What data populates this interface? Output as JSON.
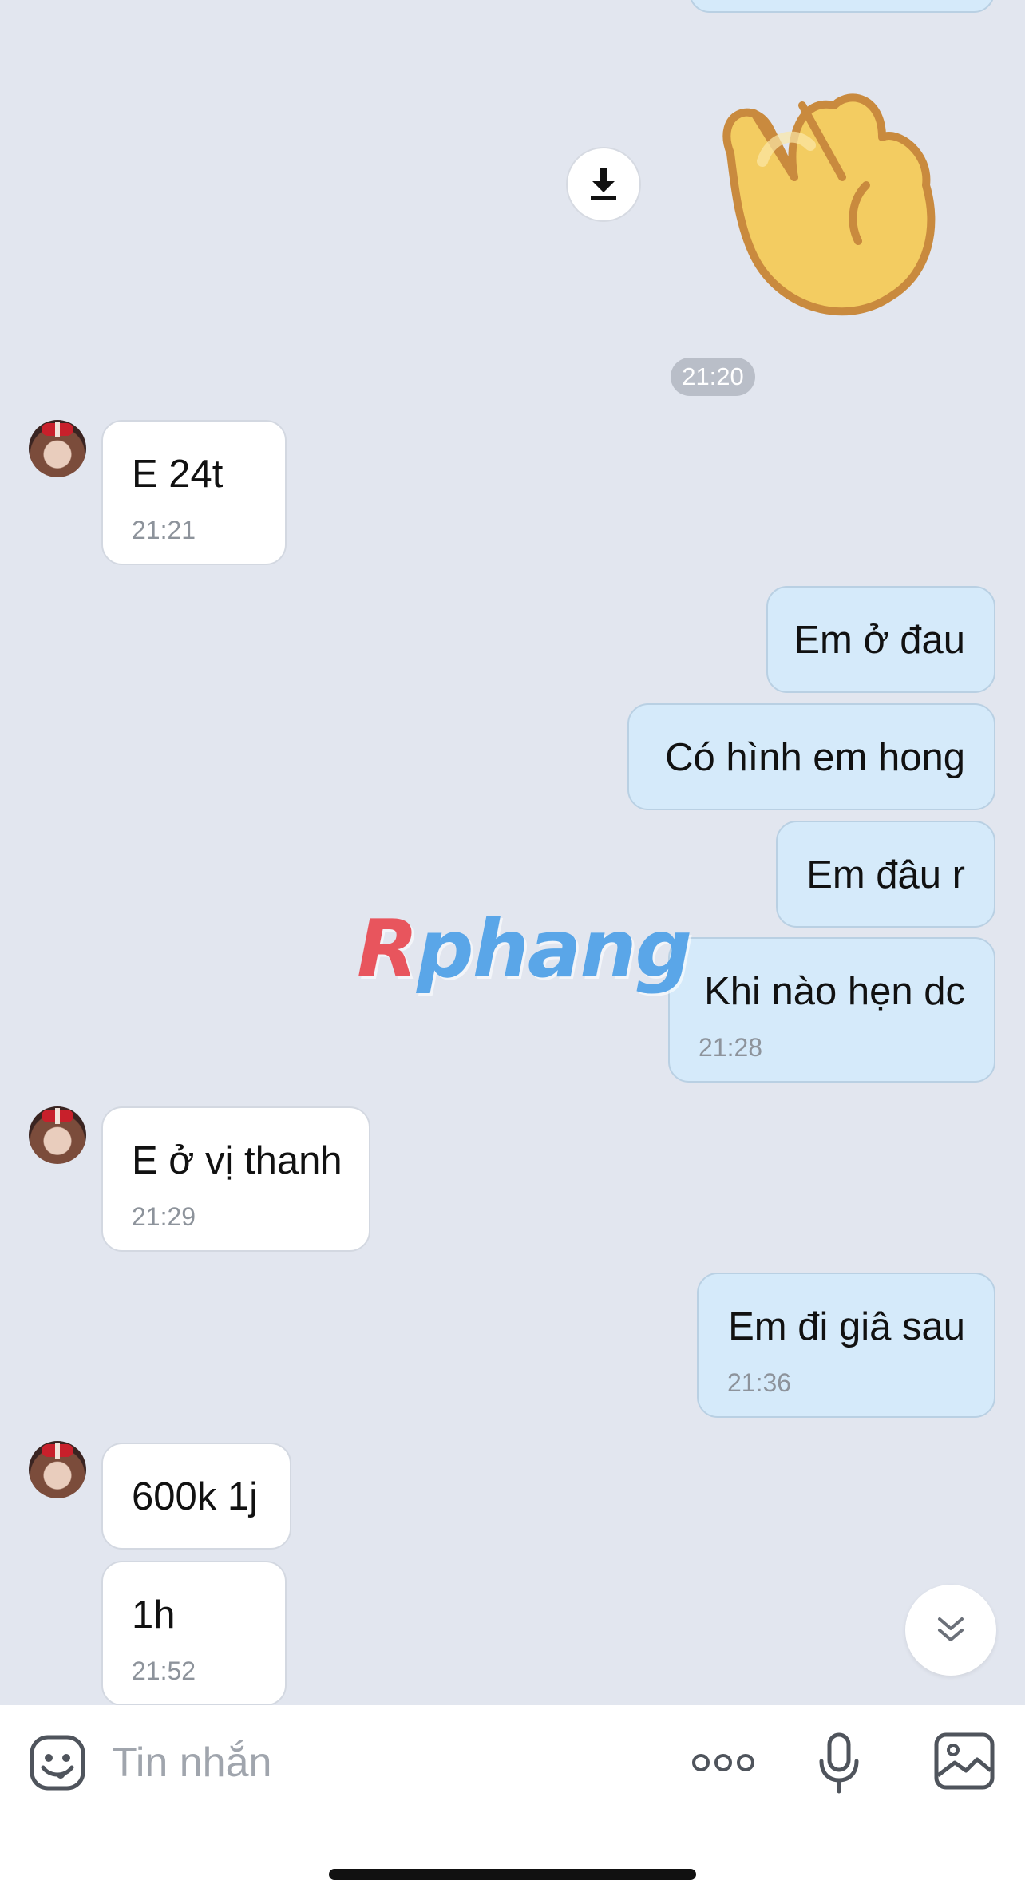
{
  "chat": {
    "time_separator": "21:20",
    "messages": [
      {
        "side": "in",
        "text": "E 24t",
        "time": "21:21"
      },
      {
        "side": "out",
        "text": "Em ở đau",
        "time": ""
      },
      {
        "side": "out",
        "text": "Có hình em hong",
        "time": ""
      },
      {
        "side": "out",
        "text": "Em đâu r",
        "time": ""
      },
      {
        "side": "out",
        "text": "Khi nào hẹn dc",
        "time": "21:28"
      },
      {
        "side": "in",
        "text": "E ở vị thanh",
        "time": "21:29"
      },
      {
        "side": "out",
        "text": "Em đi giâ sau",
        "time": "21:36"
      },
      {
        "side": "in",
        "text": "600k 1j",
        "time": ""
      },
      {
        "side": "in",
        "text": "1h",
        "time": "21:52"
      }
    ],
    "sticker": "waving-hand",
    "watermark": {
      "first": "R",
      "rest": "phang"
    }
  },
  "input": {
    "placeholder": "Tin nhắn",
    "value": ""
  },
  "colors": {
    "background": "#e2e6ef",
    "incoming_bubble": "#ffffff",
    "outgoing_bubble": "#d5eafa",
    "timestamp": "#8d939b"
  },
  "icons": [
    "download-icon",
    "chevron-double-down-icon",
    "emoji-icon",
    "more-icon",
    "microphone-icon",
    "image-icon"
  ]
}
